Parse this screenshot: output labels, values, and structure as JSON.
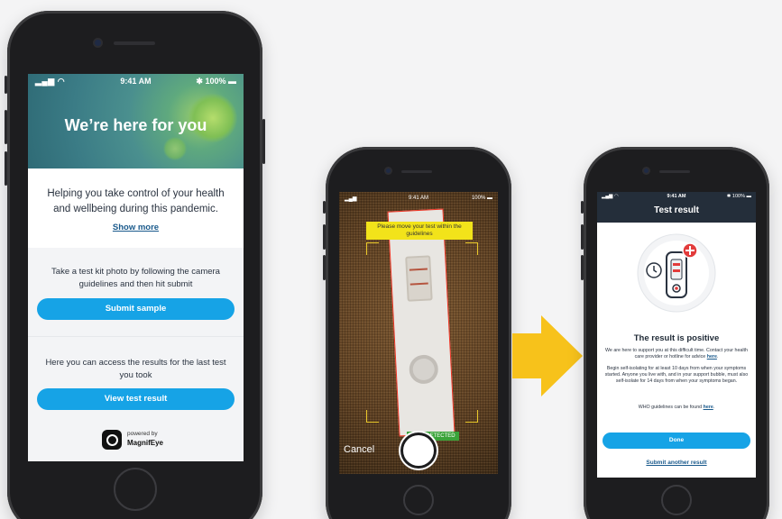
{
  "home_screen": {
    "status": {
      "signal": "all",
      "time": "9:41 AM",
      "battery": "100%"
    },
    "hero_title": "We’re here for you",
    "intro_text": "Helping you take control of your health and wellbeing during this pandemic.",
    "show_more": "Show more",
    "submit_section_text": "Take a test kit photo by following the camera guidelines and then hit submit",
    "submit_button": "Submit sample",
    "results_section_text": "Here you can access the results for the last test you took",
    "view_button": "View test result",
    "powered_by": "powered by",
    "brand": "MagnifEye"
  },
  "camera_screen": {
    "status": {
      "signal": "all",
      "time": "9:41 AM",
      "battery": "100%"
    },
    "guide_message": "Please move your test within the guidelines",
    "detected_label": "TEST DETECTED",
    "cancel_label": "Cancel"
  },
  "result_screen": {
    "status": {
      "signal": "all",
      "time": "9:41 AM",
      "battery": "100%"
    },
    "title": "Test result",
    "result_heading": "The result is positive",
    "support_text": "We are here to support you at this difficult time. Contact your health care provider or hotline for advice",
    "support_link": "here",
    "isolate_text": "Begin self-isolating for at least 10 days from when your symptoms started. Anyone you live with, and in your support bubble, must also self-isolate for 14 days from when your symptoms began.",
    "who_text": "WHO guidelines can be found",
    "who_link": "here",
    "done_button": "Done",
    "another_link": "Submit another result"
  },
  "colors": {
    "accent": "#16a3e6",
    "header_dark": "#242e3a",
    "arrow": "#f7c21b",
    "positive_red": "#e23b3b"
  }
}
